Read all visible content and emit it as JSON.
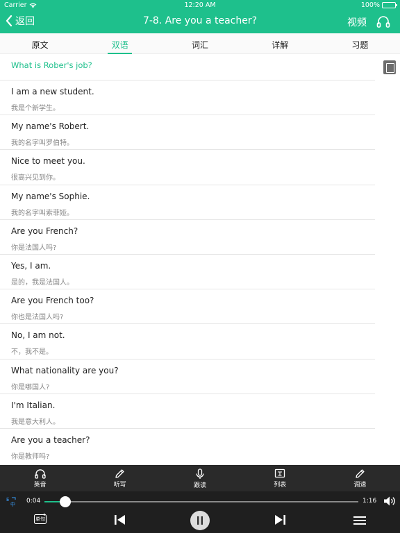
{
  "status": {
    "carrier": "Carrier",
    "time": "12:20 AM",
    "battery": "100%"
  },
  "nav": {
    "back_label": "返回",
    "title": "7-8.  Are you a teacher?",
    "video_label": "视频"
  },
  "tabs": [
    {
      "label": "原文"
    },
    {
      "label": "双语",
      "active": true
    },
    {
      "label": "词汇"
    },
    {
      "label": "详解"
    },
    {
      "label": "习题"
    }
  ],
  "content": {
    "question": "What is Rober's job?",
    "sentences": [
      {
        "en": "I am a new student.",
        "zh": "我是个新学生。"
      },
      {
        "en": "My name's Robert.",
        "zh": "我的名字叫罗伯特。"
      },
      {
        "en": "Nice to meet you.",
        "zh": "很高兴见到你。"
      },
      {
        "en": "My name's Sophie.",
        "zh": "我的名字叫索菲娅。"
      },
      {
        "en": "Are you French?",
        "zh": "你是法国人吗?"
      },
      {
        "en": "Yes, I am.",
        "zh": "是的，我是法国人。"
      },
      {
        "en": "Are you French too?",
        "zh": "你也是法国人吗?"
      },
      {
        "en": "No, I am not.",
        "zh": "不，我不是。"
      },
      {
        "en": "What nationality are you?",
        "zh": "你是哪国人?"
      },
      {
        "en": "I'm Italian.",
        "zh": "我是意大利人。"
      },
      {
        "en": "Are you a teacher?",
        "zh": "你是教师吗?"
      }
    ]
  },
  "toolbar": [
    {
      "label": "英音",
      "icon": "headphones-icon"
    },
    {
      "label": "听写",
      "icon": "pencil-icon"
    },
    {
      "label": "跟读",
      "icon": "microphone-icon"
    },
    {
      "label": "列表",
      "icon": "list-icon"
    },
    {
      "label": "调速",
      "icon": "pencil-icon"
    }
  ],
  "player": {
    "current_time": "0:04",
    "duration": "1:16",
    "progress": 0.066,
    "single_label": "单句"
  },
  "colors": {
    "accent": "#1ec08c",
    "toolbar_bg": "#2a2a2a",
    "player_bg": "#1f1f1f"
  }
}
